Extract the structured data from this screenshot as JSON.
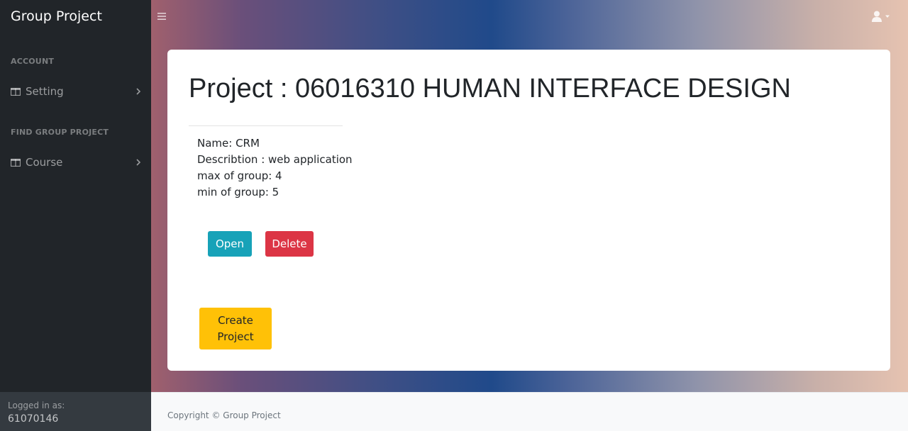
{
  "sidebar": {
    "brand": "Group Project",
    "sections": [
      {
        "heading": "ACCOUNT",
        "items": [
          {
            "label": "Setting",
            "icon": "columns-icon"
          }
        ]
      },
      {
        "heading": "FIND GROUP PROJECT",
        "items": [
          {
            "label": "Course",
            "icon": "columns-icon"
          }
        ]
      }
    ],
    "footer": {
      "logged_label": "Logged in as:",
      "username": "61070146"
    }
  },
  "topbar": {
    "menu_icon": "hamburger-icon",
    "user_icon": "user-icon"
  },
  "main": {
    "title": "Project : 06016310 HUMAN INTERFACE DESIGN",
    "project": {
      "name": "Name: CRM",
      "description": "Describtion : web application",
      "max_group": "max of group: 4",
      "min_group": "min of group: 5"
    },
    "buttons": {
      "open": "Open",
      "delete": "Delete",
      "create_line1": "Create",
      "create_line2": "Project"
    }
  },
  "footer": {
    "copyright": "Copyright © Group Project"
  },
  "colors": {
    "sidebar_bg": "#212529",
    "open_button": "#17a2b8",
    "delete_button": "#dc3545",
    "create_button": "#ffc107"
  }
}
